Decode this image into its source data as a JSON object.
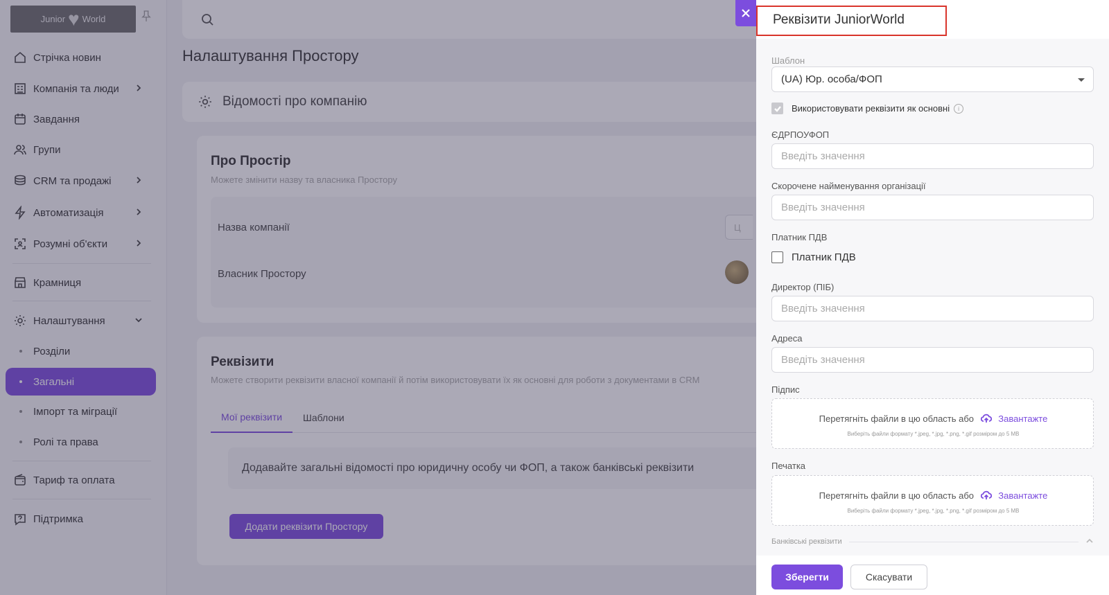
{
  "sidebar": {
    "logo_text_left": "Junior",
    "logo_text_right": "World",
    "items": [
      {
        "label": "Стрічка новин",
        "icon": "home-icon"
      },
      {
        "label": "Компанія та люди",
        "icon": "building-icon"
      },
      {
        "label": "Завдання",
        "icon": "calendar-icon"
      },
      {
        "label": "Групи",
        "icon": "users-icon"
      },
      {
        "label": "CRM та продажі",
        "icon": "coins-icon"
      },
      {
        "label": "Автоматизація",
        "icon": "bolt-icon"
      },
      {
        "label": "Розумні об'єкти",
        "icon": "scan-icon"
      },
      {
        "label": "Крамниця",
        "icon": "store-icon"
      },
      {
        "label": "Налаштування",
        "icon": "gear-icon"
      },
      {
        "label": "Тариф та оплата",
        "icon": "wallet-icon"
      },
      {
        "label": "Підтримка",
        "icon": "help-icon"
      }
    ],
    "sub_items": [
      {
        "label": "Розділи"
      },
      {
        "label": "Загальні"
      },
      {
        "label": "Імпорт та міграції"
      },
      {
        "label": "Ролі та права"
      }
    ]
  },
  "main": {
    "page_title": "Налаштування Простору",
    "company_info_title": "Відомості про компанію",
    "about": {
      "title": "Про Простір",
      "subtitle": "Можете змінити назву та власника Простору",
      "company_name_label": "Назва компанії",
      "company_name_value": "Ц",
      "owner_label": "Власник Простору"
    },
    "requisites": {
      "title": "Реквізити",
      "subtitle": "Можете створити реквізити власної компанії й потім використовувати їх як основні для роботи з документами в CRM",
      "tabs": [
        "Мої реквізити",
        "Шаблони"
      ],
      "info": "Додавайте загальні відомості про юридичну особу чи ФОП, а також банківські реквізити",
      "add_button": "Додати реквізити Простору"
    }
  },
  "drawer": {
    "title": "Реквізити JuniorWorld",
    "template_label": "Шаблон",
    "template_value": "(UA) Юр. особа/ФОП",
    "use_as_main_label": "Використовувати реквізити як основні",
    "edrpou_label": "ЄДРПОУФОП",
    "edrpou_placeholder": "Введіть значення",
    "short_name_label": "Скорочене найменування організації",
    "short_name_placeholder": "Введіть значення",
    "vat_payer_section": "Платник ПДВ",
    "vat_payer_checkbox": "Платник ПДВ",
    "director_label": "Директор (ПІБ)",
    "director_placeholder": "Введіть значення",
    "address_label": "Адреса",
    "address_placeholder": "Введіть значення",
    "signature_label": "Підпис",
    "stamp_label": "Печатка",
    "dropzone_text": "Перетягніть файли в цю область або",
    "dropzone_upload": "Завантажте",
    "dropzone_hint": "Виберіть файли формату *.jpeg, *.jpg, *.png, *.gif розміром до 5 MB",
    "bank_section": "Банківські реквізити",
    "save_button": "Зберегти",
    "cancel_button": "Скасувати"
  },
  "colors": {
    "accent": "#7c4dde",
    "highlight_border": "#d9342b"
  }
}
